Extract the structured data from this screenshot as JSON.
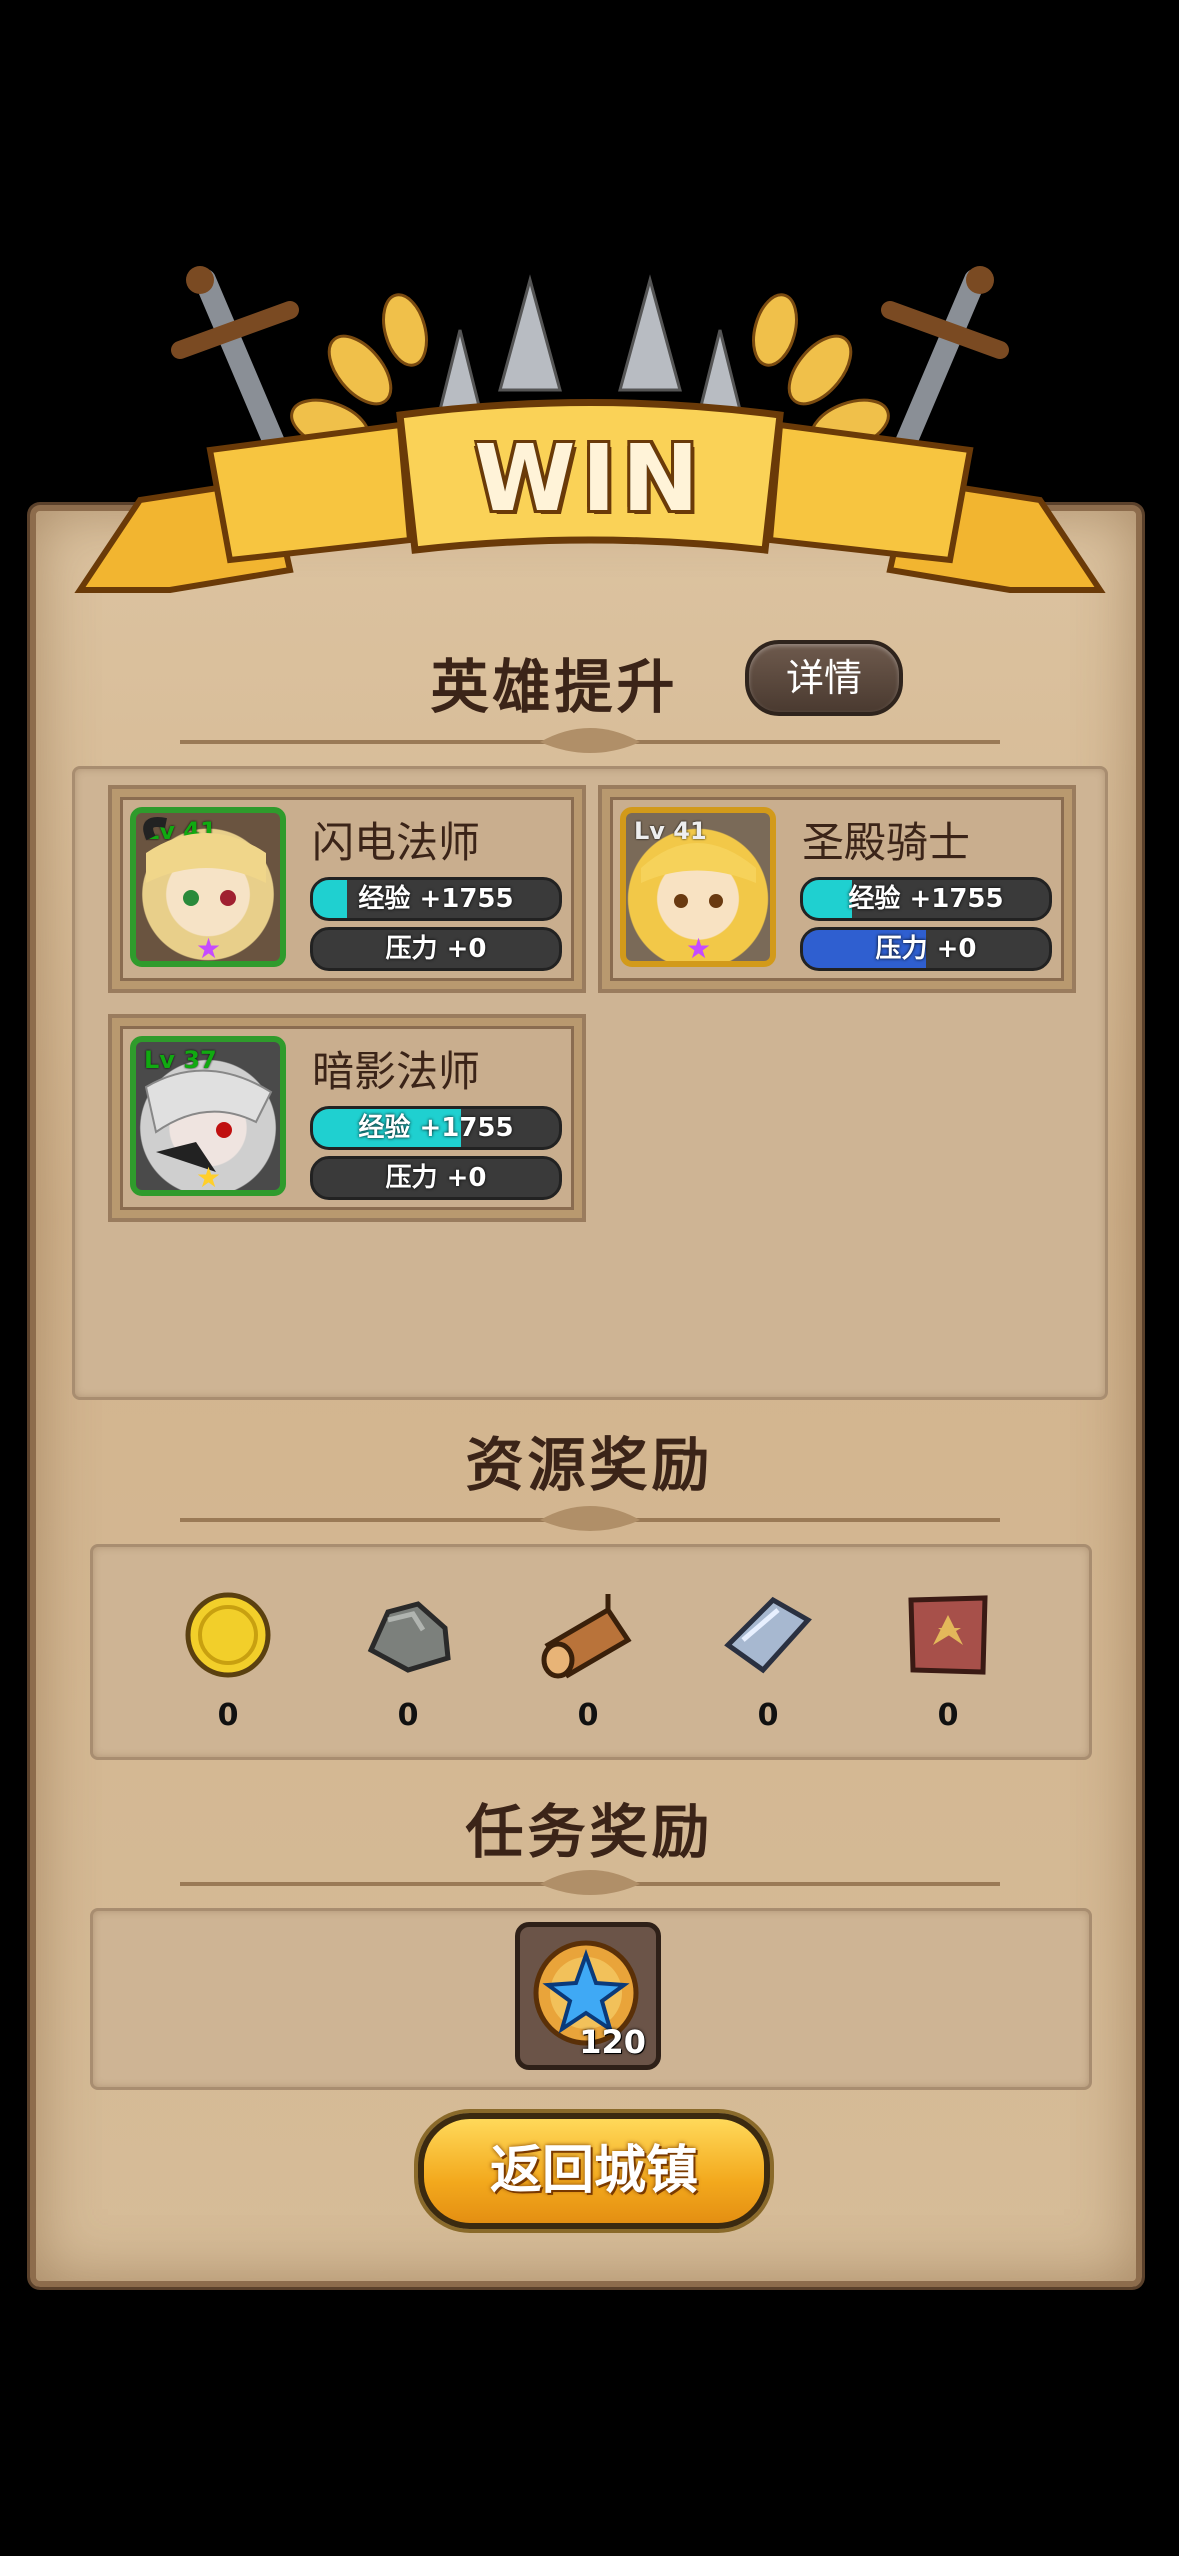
{
  "banner": {
    "title": "WIN"
  },
  "hero_section": {
    "title": "英雄提升",
    "details_label": "详情"
  },
  "heroes": [
    {
      "level": "Lv 41",
      "name": "闪电法师",
      "exp_label": "经验 +1755",
      "stress_label": "压力 +0",
      "exp_fill": 0.14,
      "stress_fill": 0.0,
      "frame_color": "#2f9b2c",
      "star_color": "#c64bff"
    },
    {
      "level": "Lv 41",
      "name": "圣殿骑士",
      "exp_label": "经验 +1755",
      "stress_label": "压力 +0",
      "exp_fill": 0.2,
      "stress_fill": 0.5,
      "frame_color": "#d29a1a",
      "star_color": "#c64bff"
    },
    {
      "level": "Lv 37",
      "name": "暗影法师",
      "exp_label": "经验 +1755",
      "stress_label": "压力 +0",
      "exp_fill": 0.6,
      "stress_fill": 0.0,
      "frame_color": "#2f9b2c",
      "star_color": "#ffcf2a"
    }
  ],
  "resources_section": {
    "title": "资源奖励"
  },
  "resources": [
    {
      "icon": "gold-coin-icon",
      "count": "0"
    },
    {
      "icon": "stone-icon",
      "count": "0"
    },
    {
      "icon": "wood-log-icon",
      "count": "0"
    },
    {
      "icon": "iron-ingot-icon",
      "count": "0"
    },
    {
      "icon": "leather-icon",
      "count": "0"
    }
  ],
  "quest_section": {
    "title": "任务奖励"
  },
  "quest_reward": {
    "icon": "star-medal-icon",
    "count": "120"
  },
  "return_button": {
    "label": "返回城镇"
  },
  "colors": {
    "exp_fill": "#1fd0d0",
    "stress_fill": "#2f5fd0",
    "parchment": "#d2b48e"
  }
}
